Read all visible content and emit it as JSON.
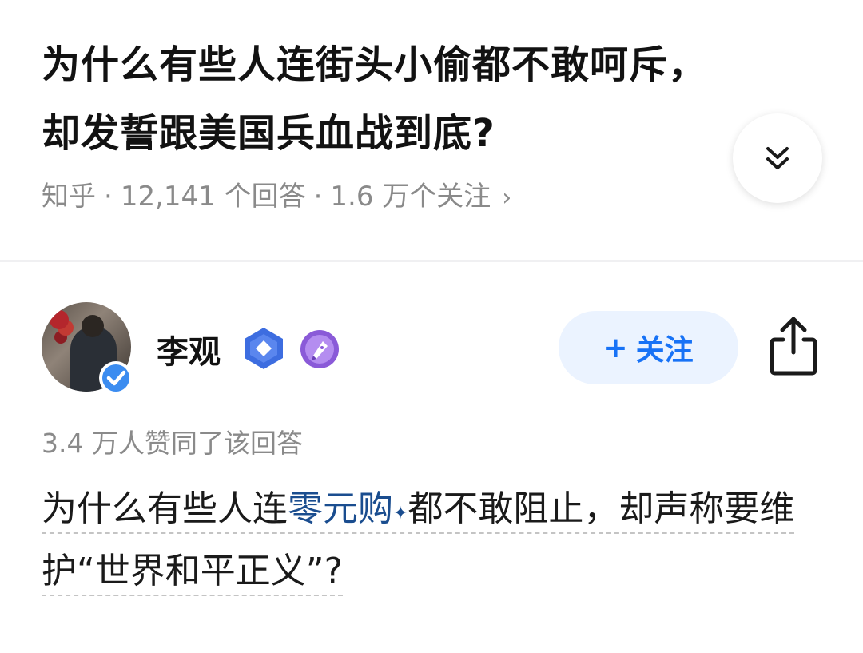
{
  "question": {
    "title": "为什么有些人连街头小偷都不敢呵斥，却发誓跟美国兵血战到底?",
    "source": "知乎",
    "answers": "12,141 个回答",
    "followers": "1.6 万个关注",
    "separator": "·",
    "chevron": "›"
  },
  "author": {
    "name": "李观",
    "follow_label": "关注",
    "follow_plus": "+"
  },
  "answer": {
    "upvotes": "3.4 万人赞同了该回答",
    "excerpt_pre": "为什么有些人连",
    "excerpt_link": "零元购",
    "excerpt_spark": "✦",
    "excerpt_post": "都不敢阻止，却声称要维护“世界和平正义”?"
  },
  "colors": {
    "accent": "#1772f6",
    "follow_bg": "#ebf3ff",
    "meta_gray": "#8a8a8a",
    "link": "#1a4d8f",
    "badge_blue": "#3d6de0",
    "badge_purple": "#8a5ad8"
  },
  "icons": {
    "expand": "double-chevron-down-icon",
    "share": "share-icon",
    "verified": "verified-check-icon",
    "badge1": "blue-diamond-badge-icon",
    "badge2": "fountain-pen-badge-icon"
  }
}
